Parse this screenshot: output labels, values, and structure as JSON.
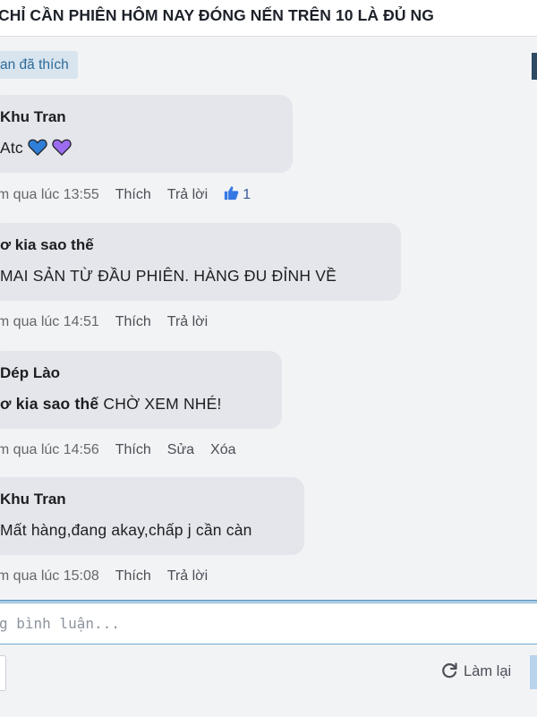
{
  "post": {
    "title": "CHỈ CẦN PHIÊN HÔM NAY ĐÓNG NẾN TRÊN 10 LÀ ĐỦ NG"
  },
  "liked_label": "an đã thích",
  "comments": [
    {
      "author": "Khu Tran",
      "text": "Atc",
      "hearts": [
        "blue-heart-icon",
        "purple-heart-icon"
      ],
      "time": "ôm qua lúc 13:55",
      "actions": [
        "Thích",
        "Trả lời"
      ],
      "likes": "1"
    },
    {
      "author": "ơ kia sao thế",
      "text": "MAI SẢN TỪ ĐẦU PHIÊN. HÀNG ĐU ĐỈNH VỀ",
      "time": "ôm qua lúc 14:51",
      "actions": [
        "Thích",
        "Trả lời"
      ]
    },
    {
      "author": "Dép Lào",
      "mention": "ơ kia sao thế",
      "text": " CHỜ XEM NHÉ!",
      "time": "ôm qua lúc 14:56",
      "actions": [
        "Thích",
        "Sửa",
        "Xóa"
      ]
    },
    {
      "author": "Khu Tran",
      "text": "Mất hàng,đang akay,chấp j cần càn",
      "time": "ôm qua lúc 15:08",
      "actions": [
        "Thích",
        "Trả lời"
      ]
    }
  ],
  "input": {
    "placeholder": "g bình luận..."
  },
  "footer": {
    "refresh_label": "Làm lại"
  },
  "colors": {
    "bubble": "#e4e6eb",
    "background": "#f2f3f5",
    "link_blue": "#385898",
    "input_border": "#6ea6cf"
  }
}
